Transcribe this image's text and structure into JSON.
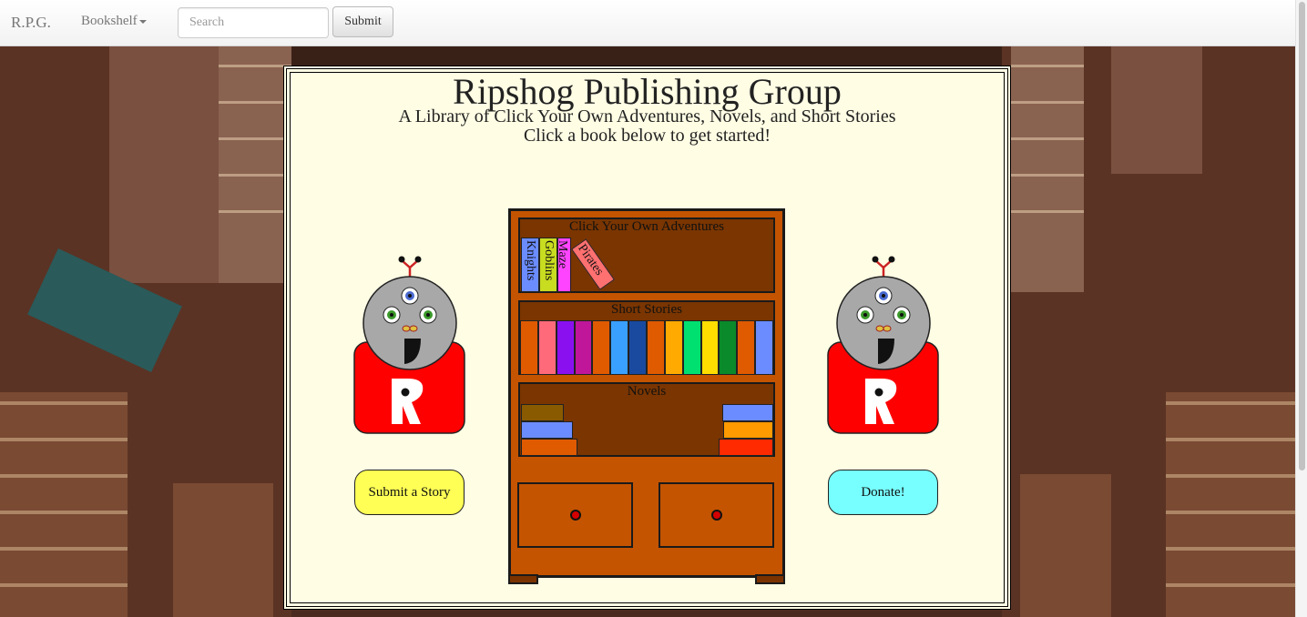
{
  "navbar": {
    "brand": "R.P.G.",
    "dropdown_label": "Bookshelf",
    "search_placeholder": "Search",
    "submit_label": "Submit"
  },
  "header": {
    "title": "Ripshog Publishing Group",
    "subtitle": "A Library of Click Your Own Adventures, Novels, and Short Stories",
    "instruction": "Click a book below to get started!"
  },
  "bookshelf": {
    "adventures_label": "Click Your Own Adventures",
    "adventure_books": [
      {
        "title": "Knights",
        "color": "#6b8cff"
      },
      {
        "title": "Goblins",
        "color": "#c8dc20"
      },
      {
        "title": "Maze",
        "color": "#ff44ff"
      },
      {
        "title": "Pirates",
        "color": "#ff7070"
      }
    ],
    "short_stories_label": "Short Stories",
    "short_story_colors": [
      "#e05a00",
      "#ff6a7a",
      "#8a10f0",
      "#c0169a",
      "#e05a00",
      "#3aa0ff",
      "#1a4aa0",
      "#e05a00",
      "#ffaa00",
      "#00e070",
      "#ffdd00",
      "#0a8a2a",
      "#e05a00",
      "#6b8cff"
    ],
    "novels_label": "Novels",
    "novel_colors_left": [
      "#8a5a00",
      "#6b8cff",
      "#e05a00"
    ],
    "novel_colors_right": [
      "#6b8cff",
      "#ff9a00",
      "#ff2a00"
    ]
  },
  "actions": {
    "submit_story_label": "Submit a Story",
    "donate_label": "Donate!",
    "submit_story_color": "#ffff55",
    "donate_color": "#77ffff"
  },
  "mascot": {
    "logo_letter": "R",
    "body_color": "#ff0000",
    "head_color": "#a8a8a8"
  }
}
